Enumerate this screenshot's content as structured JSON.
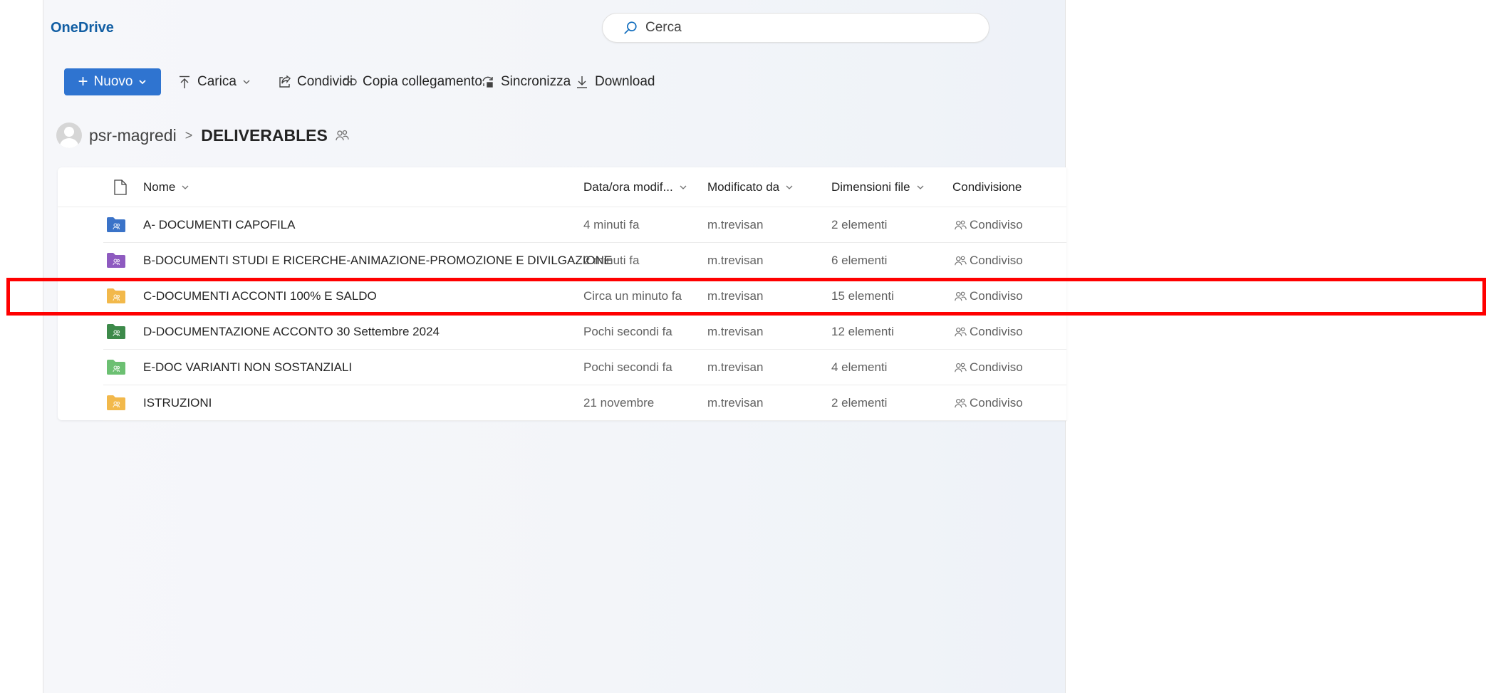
{
  "app": {
    "title": "OneDrive"
  },
  "search": {
    "placeholder": "Cerca",
    "icon": "search-icon"
  },
  "toolbar": {
    "new_label": "Nuovo",
    "upload_label": "Carica",
    "share_label": "Condividi",
    "copy_link_label": "Copia collegamento",
    "sync_label": "Sincronizza",
    "download_label": "Download"
  },
  "breadcrumb": {
    "root": "psr-magredi",
    "current": "DELIVERABLES"
  },
  "table": {
    "headers": {
      "name": "Nome",
      "modified": "Data/ora modif...",
      "modified_by": "Modificato da",
      "size": "Dimensioni file",
      "sharing": "Condivisione"
    },
    "rows": [
      {
        "name": "A- DOCUMENTI CAPOFILA",
        "modified": "4 minuti fa",
        "modified_by": "m.trevisan",
        "size": "2 elementi",
        "sharing": "Condiviso",
        "folder_color": "#3b73c8"
      },
      {
        "name": "B-DOCUMENTI STUDI E RICERCHE-ANIMAZIONE-PROMOZIONE E DIVILGAZIONE",
        "modified": "2 minuti fa",
        "modified_by": "m.trevisan",
        "size": "6 elementi",
        "sharing": "Condiviso",
        "folder_color": "#8e5bbf"
      },
      {
        "name": "C-DOCUMENTI ACCONTI 100% E SALDO",
        "modified": "Circa un minuto fa",
        "modified_by": "m.trevisan",
        "size": "15 elementi",
        "sharing": "Condiviso",
        "folder_color": "#f2b84b"
      },
      {
        "name": "D-DOCUMENTAZIONE ACCONTO 30 Settembre 2024",
        "modified": "Pochi secondi fa",
        "modified_by": "m.trevisan",
        "size": "12 elementi",
        "sharing": "Condiviso",
        "folder_color": "#3d8a4a"
      },
      {
        "name": "E-DOC VARIANTI NON SOSTANZIALI",
        "modified": "Pochi secondi fa",
        "modified_by": "m.trevisan",
        "size": "4 elementi",
        "sharing": "Condiviso",
        "folder_color": "#6cbf72"
      },
      {
        "name": "ISTRUZIONI",
        "modified": "21 novembre",
        "modified_by": "m.trevisan",
        "size": "2 elementi",
        "sharing": "Condiviso",
        "folder_color": "#f2b84b"
      }
    ]
  },
  "colors": {
    "accent": "#2f74d0",
    "brand_text": "#115ea3",
    "highlight": "#ff0000"
  }
}
